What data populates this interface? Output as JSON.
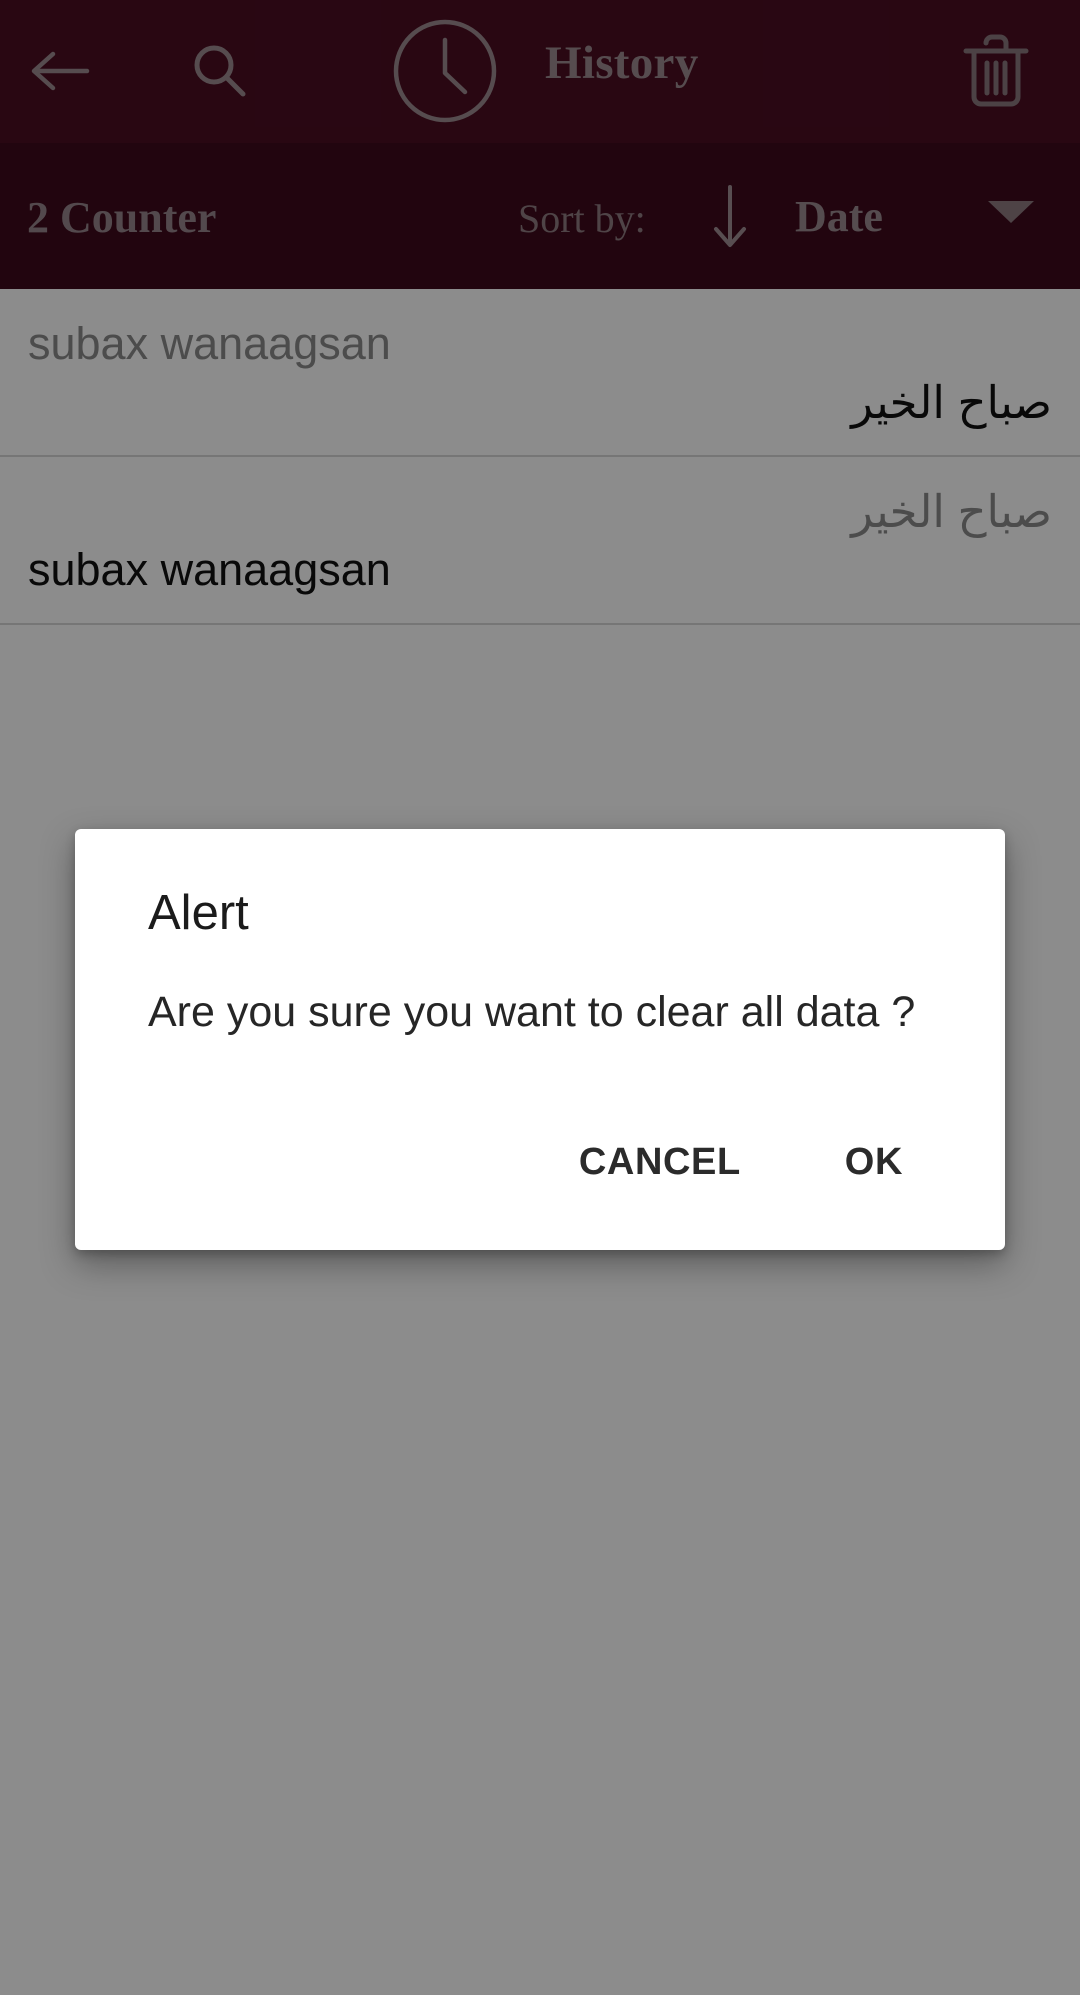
{
  "appbar": {
    "back_icon": "back-arrow-icon",
    "search_icon": "search-icon",
    "clock_icon": "clock-icon",
    "title": "History",
    "delete_icon": "trash-icon",
    "background_color": "#4b0d22",
    "foreground_color": "#9d8a90"
  },
  "sortbar": {
    "counter": "2 Counter",
    "sort_by_label": "Sort by:",
    "sort_direction_icon": "arrow-down-icon",
    "sort_value": "Date",
    "dropdown_icon": "chevron-down-icon",
    "background_color": "#3e0a1c"
  },
  "history": {
    "items": [
      {
        "source_text": "subax wanaagsan",
        "source_dir": "ltr",
        "translation_text": "صباح الخير",
        "translation_dir": "rtl"
      },
      {
        "source_text": "صباح الخير",
        "source_dir": "rtl",
        "translation_text": "subax wanaagsan",
        "translation_dir": "ltr"
      }
    ]
  },
  "dialog": {
    "title": "Alert",
    "message": "Are you sure you want to clear all data ?",
    "cancel_label": "CANCEL",
    "ok_label": "OK",
    "background_color": "#ffffff"
  }
}
